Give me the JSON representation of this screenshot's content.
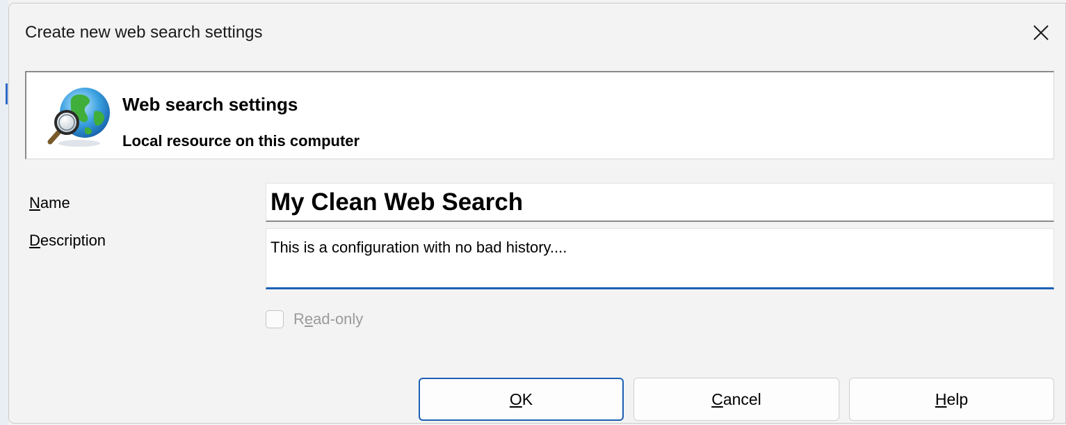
{
  "dialog": {
    "title": "Create new web search settings"
  },
  "header": {
    "icon": "globe-magnifier-icon",
    "title": "Web search settings",
    "subtitle": "Local resource on this computer"
  },
  "form": {
    "name_label_mnemonic": "N",
    "name_label_rest": "ame",
    "name_value": "My Clean Web Search",
    "description_label_mnemonic": "D",
    "description_label_rest": "escription",
    "description_value": "This is a configuration with no bad history....",
    "readonly_label_pre": "R",
    "readonly_label_mnemonic": "e",
    "readonly_label_rest": "ad-only",
    "readonly_checked": false,
    "readonly_enabled": false
  },
  "buttons": {
    "ok_mnemonic": "O",
    "ok_rest": "K",
    "cancel_mnemonic": "C",
    "cancel_rest": "ancel",
    "help_mnemonic": "H",
    "help_rest": "elp"
  },
  "colors": {
    "accent": "#1a5fb4",
    "dialog_bg": "#f3f3f3",
    "disabled_text": "#9a9a9a"
  }
}
